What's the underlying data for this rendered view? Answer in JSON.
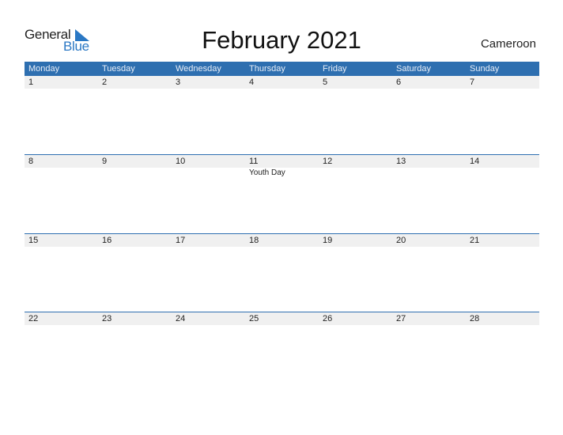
{
  "logo": {
    "word1": "General",
    "word2": "Blue"
  },
  "title": "February 2021",
  "country": "Cameroon",
  "colors": {
    "accent": "#2e6fb0",
    "row_bg": "#f0f0f0"
  },
  "weekdays": [
    "Monday",
    "Tuesday",
    "Wednesday",
    "Thursday",
    "Friday",
    "Saturday",
    "Sunday"
  ],
  "weeks": [
    {
      "days": [
        "1",
        "2",
        "3",
        "4",
        "5",
        "6",
        "7"
      ],
      "events": [
        "",
        "",
        "",
        "",
        "",
        "",
        ""
      ]
    },
    {
      "days": [
        "8",
        "9",
        "10",
        "11",
        "12",
        "13",
        "14"
      ],
      "events": [
        "",
        "",
        "",
        "Youth Day",
        "",
        "",
        ""
      ]
    },
    {
      "days": [
        "15",
        "16",
        "17",
        "18",
        "19",
        "20",
        "21"
      ],
      "events": [
        "",
        "",
        "",
        "",
        "",
        "",
        ""
      ]
    },
    {
      "days": [
        "22",
        "23",
        "24",
        "25",
        "26",
        "27",
        "28"
      ],
      "events": [
        "",
        "",
        "",
        "",
        "",
        "",
        ""
      ]
    }
  ]
}
